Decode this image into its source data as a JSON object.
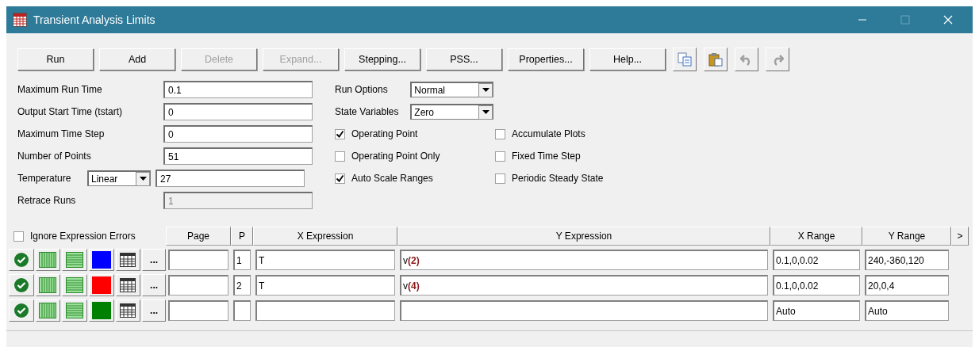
{
  "window": {
    "title": "Transient Analysis Limits"
  },
  "toolbar": {
    "buttons": [
      {
        "label": "Run",
        "disabled": false
      },
      {
        "label": "Add",
        "disabled": false
      },
      {
        "label": "Delete",
        "disabled": true
      },
      {
        "label": "Expand...",
        "disabled": true
      },
      {
        "label": "Stepping...",
        "disabled": false
      },
      {
        "label": "PSS...",
        "disabled": false
      },
      {
        "label": "Properties...",
        "disabled": false
      },
      {
        "label": "Help...",
        "disabled": false
      }
    ],
    "icons": [
      {
        "kind": "copy",
        "disabled": false
      },
      {
        "kind": "paste",
        "disabled": false
      },
      {
        "kind": "undo",
        "disabled": true
      },
      {
        "kind": "redo",
        "disabled": true
      }
    ]
  },
  "fields": [
    {
      "label": "Maximum Run Time",
      "value": "0.1",
      "disabled": false
    },
    {
      "label": "Output Start Time (tstart)",
      "value": "0",
      "disabled": false
    },
    {
      "label": "Maximum Time Step",
      "value": "0",
      "disabled": false
    },
    {
      "label": "Number of Points",
      "value": "51",
      "disabled": false
    },
    {
      "label": "Temperature",
      "mode": "Linear",
      "value": "27",
      "disabled": false
    },
    {
      "label": "Retrace Runs",
      "value": "1",
      "disabled": true
    }
  ],
  "selects": [
    {
      "label": "Run Options",
      "value": "Normal"
    },
    {
      "label": "State Variables",
      "value": "Zero"
    }
  ],
  "options_left": [
    {
      "label": "Operating Point",
      "checked": true
    },
    {
      "label": "Operating Point Only",
      "checked": false
    },
    {
      "label": "Auto Scale Ranges",
      "checked": true
    }
  ],
  "options_right": [
    {
      "label": "Accumulate Plots",
      "checked": false
    },
    {
      "label": "Fixed Time Step",
      "checked": false
    },
    {
      "label": "Periodic Steady State",
      "checked": false
    }
  ],
  "table": {
    "ignore_errors": {
      "label": "Ignore Expression Errors",
      "checked": false
    },
    "columns": [
      "Page",
      "P",
      "X Expression",
      "Y Expression",
      "X Range",
      "Y Range"
    ],
    "more_columns": ">",
    "rows": [
      {
        "color": "#0000ff",
        "more": "...",
        "p": "1",
        "x_expression": "T",
        "y_expression": "v**(2)**",
        "x_range": "0.1,0,0.02",
        "y_range": "240,-360,120"
      },
      {
        "color": "#ff0000",
        "more": "...",
        "p": "2",
        "x_expression": "T",
        "y_expression": "v**(4)**",
        "x_range": "0.1,0,0.02",
        "y_range": "20,0,4"
      },
      {
        "color": "#008000",
        "more": "...",
        "x_range": "Auto",
        "y_range": "Auto"
      }
    ]
  }
}
